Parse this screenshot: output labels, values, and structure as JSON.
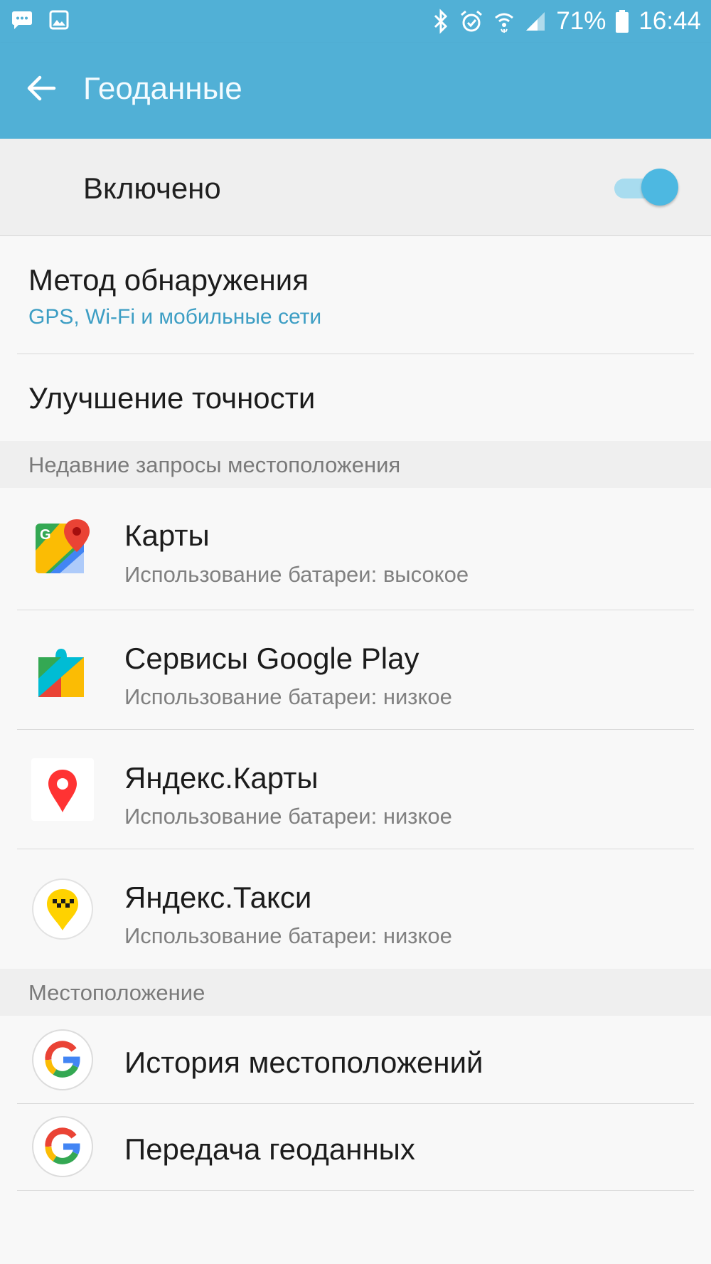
{
  "status_bar": {
    "battery": "71%",
    "time": "16:44",
    "icons": [
      "message-icon",
      "gallery-icon",
      "bluetooth-icon",
      "alarm-icon",
      "wifi-icon",
      "signal-icon",
      "battery-icon"
    ]
  },
  "app_bar": {
    "title": "Геоданные",
    "back_icon": "arrow-left-icon"
  },
  "master_switch": {
    "label": "Включено",
    "state": "on"
  },
  "settings": [
    {
      "title": "Метод обнаружения",
      "subtitle": "GPS, Wi-Fi и мобильные сети"
    },
    {
      "title": "Улучшение точности"
    }
  ],
  "recent_section": {
    "label": "Недавние запросы местоположения",
    "apps": [
      {
        "name": "Карты",
        "battery": "Использование батареи: высокое",
        "icon": "google-maps-icon"
      },
      {
        "name": "Сервисы Google Play",
        "battery": "Использование батареи: низкое",
        "icon": "google-play-services-icon"
      },
      {
        "name": "Яндекс.Карты",
        "battery": "Использование батареи: низкое",
        "icon": "yandex-maps-icon"
      },
      {
        "name": "Яндекс.Такси",
        "battery": "Использование батареи: низкое",
        "icon": "yandex-taxi-icon"
      }
    ]
  },
  "location_section": {
    "label": "Местоположение",
    "items": [
      {
        "title": "История местоположений",
        "icon": "google-icon"
      },
      {
        "title": "Передача геоданных",
        "icon": "google-icon"
      }
    ]
  },
  "colors": {
    "accent": "#51b0d6",
    "toggle_on": "#4db8e1",
    "subtitle_blue": "#3d9ec4"
  }
}
